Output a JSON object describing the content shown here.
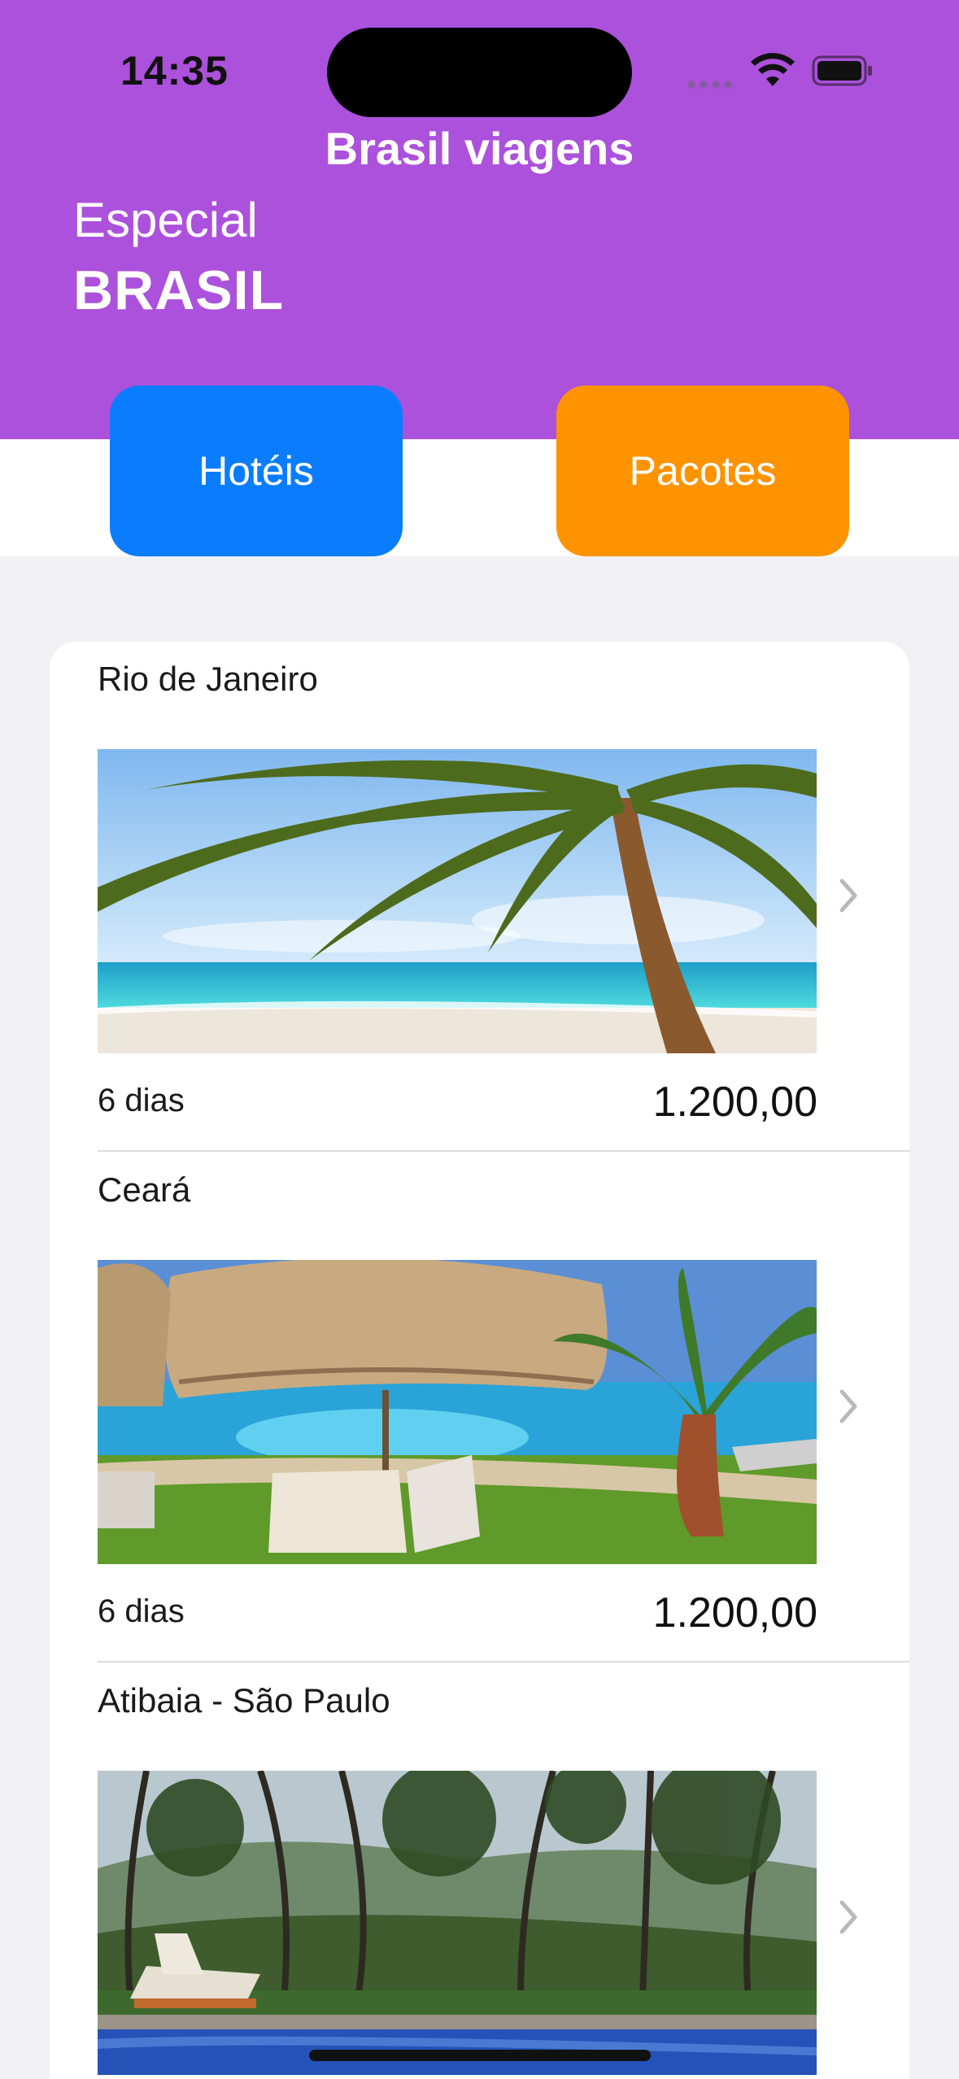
{
  "status_bar": {
    "time": "14:35"
  },
  "header": {
    "app_title": "Brasil viagens",
    "subtitle": "Especial",
    "title": "BRASIL",
    "hotels_label": "Hotéis",
    "packages_label": "Pacotes"
  },
  "colors": {
    "header_bg": "#ac51dc",
    "hotels_button": "#0a7dff",
    "packages_button": "#fe9300"
  },
  "packages": [
    {
      "title": "Rio de Janeiro",
      "duration": "6 dias",
      "price": "1.200,00",
      "image": "beach-palm-image"
    },
    {
      "title": "Ceará",
      "duration": "6 dias",
      "price": "1.200,00",
      "image": "pool-resort-image"
    },
    {
      "title": "Atibaia - São Paulo",
      "image": "forest-pool-image"
    }
  ]
}
